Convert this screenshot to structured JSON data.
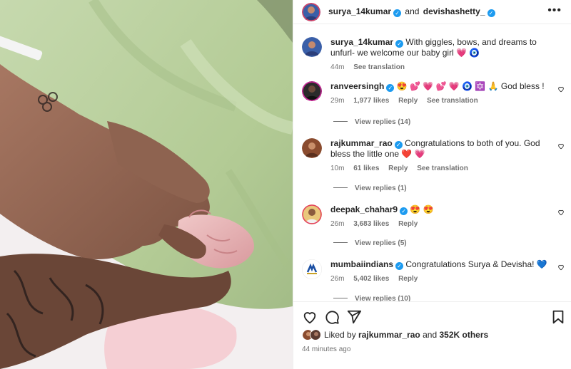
{
  "header": {
    "author": "surya_14kumar",
    "and": "and",
    "coauthor": "devishashetty_",
    "more": "•••"
  },
  "caption": {
    "user": "surya_14kumar",
    "text": "With giggles, bows, and dreams to unfurl- we welcome our baby girl 💗 🧿",
    "time": "44m",
    "see_translation": "See translation"
  },
  "comments": [
    {
      "user": "ranveersingh",
      "text": "😍 💕 💗 💕 💗 🧿 🔯 🙏 God bless !",
      "time": "29m",
      "likes": "1,977 likes",
      "reply": "Reply",
      "translate": "See translation",
      "view_replies": "View replies (14)"
    },
    {
      "user": "rajkummar_rao",
      "text": "Congratulations to both of you. God bless the little one ❤️ 💗",
      "time": "10m",
      "likes": "61 likes",
      "reply": "Reply",
      "translate": "See translation",
      "view_replies": "View replies (1)"
    },
    {
      "user": "deepak_chahar9",
      "text": "😍 😍",
      "time": "26m",
      "likes": "3,683 likes",
      "reply": "Reply",
      "translate": "",
      "view_replies": "View replies (5)"
    },
    {
      "user": "mumbaiindians",
      "text": "Congratulations Surya & Devisha! 💙",
      "time": "26m",
      "likes": "5,402 likes",
      "reply": "Reply",
      "translate": "",
      "view_replies": "View replies (10)"
    }
  ],
  "liked_by": {
    "prefix": "Liked by",
    "user": "rajkummar_rao",
    "and": "and",
    "others": "352K others"
  },
  "post_time": "44 minutes ago",
  "icons": {
    "like": "heart-icon",
    "comment": "comment-icon",
    "share": "share-icon",
    "save": "bookmark-icon"
  },
  "colors": {
    "verified": "#1d9bf0",
    "text": "#262626",
    "muted": "#737373"
  }
}
